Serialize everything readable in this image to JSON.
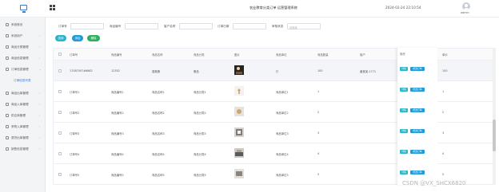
{
  "header": {
    "title": "农业教育分类订单 运营管理系统",
    "datetime": "2024-02-24 22:10:54",
    "username": "admin"
  },
  "sidebar": {
    "items": [
      {
        "label": "系统首页"
      },
      {
        "label": "系统用户"
      },
      {
        "label": "商品分类管理"
      },
      {
        "label": "商品信息管理"
      },
      {
        "label": "订单信息管理"
      },
      {
        "label": "订单信息列表"
      },
      {
        "label": "商品出库管理"
      },
      {
        "label": "商品入库管理"
      },
      {
        "label": "供应商管理"
      },
      {
        "label": "采购入库管理"
      },
      {
        "label": "退货出库管理"
      },
      {
        "label": "销售信息管理"
      }
    ]
  },
  "filters": {
    "order_no_label": "订单号",
    "goods_no_label": "商品编号",
    "customer_label": "客户名称",
    "order_date_label": "订单日期",
    "status_label": "审核状态",
    "status_placeholder": "请选择"
  },
  "buttons": {
    "search": "查询",
    "add": "添加",
    "delete": "删除"
  },
  "table": {
    "columns": [
      "订单号",
      "商品编号",
      "商品名称",
      "商品分类",
      "图片",
      "商品单位",
      "商品数量",
      "客户",
      "供应商名称",
      "单价",
      "操作"
    ],
    "rows": [
      [
        "17087007#6862",
        "12352",
        "香蕉蛋",
        "蛋品",
        "",
        "斤",
        "100",
        "姜某某-1771",
        "蛋品",
        "150"
      ],
      [
        "订单号1",
        "商品编号1",
        "商品名称1",
        "商品分类1",
        "",
        "商品单位1",
        "1",
        "",
        "供应商名称1",
        "1"
      ],
      [
        "订单号2",
        "商品编号2",
        "商品名称2",
        "商品分类2",
        "",
        "商品单位2",
        "2",
        "",
        "供应商名称2",
        "2"
      ],
      [
        "订单号3",
        "商品编号3",
        "商品名称3",
        "商品分类3",
        "",
        "商品单位3",
        "3",
        "",
        "供应商名称3",
        "3"
      ],
      [
        "订单号4",
        "商品编号4",
        "商品名称4",
        "商品分类4",
        "",
        "商品单位4",
        "4",
        "",
        "供应商名称4",
        "4"
      ],
      [
        "订单号5",
        "商品编号5",
        "商品名称5",
        "商品分类5",
        "",
        "商品单位5",
        "5",
        "",
        "供应商名称5",
        "5"
      ],
      [
        "订单号6",
        "商品编号6",
        "商品名称6",
        "商品分类6",
        "",
        "商品单位6",
        "6",
        "",
        "供应商名称6",
        "6"
      ]
    ],
    "row_actions": {
      "view": "详情",
      "edit": "修改订单"
    }
  },
  "watermark": "CSDN @VX_SHCX6820",
  "colors": {
    "accent": "#3a7bd5",
    "search_button": "#29b6c8",
    "add_button": "#1e9bd8",
    "delete_button": "#2fb25f"
  }
}
